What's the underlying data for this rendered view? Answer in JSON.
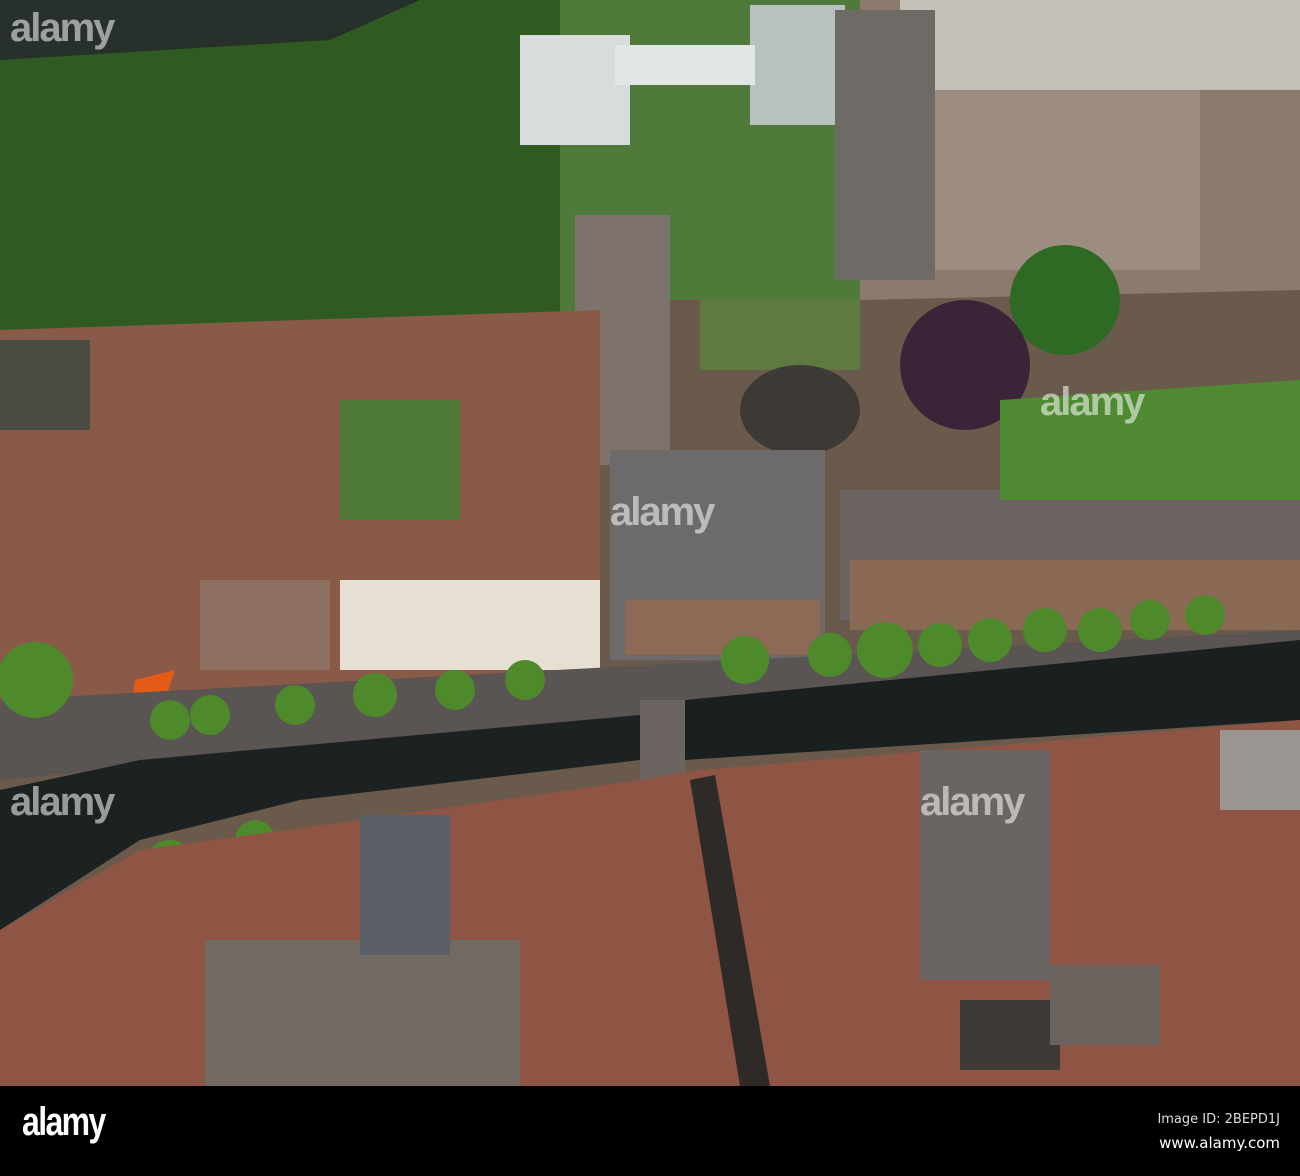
{
  "photo": {
    "description_alt": "Aerial view of canal city"
  },
  "watermark": {
    "text": "alamy"
  },
  "footer": {
    "logo": "alamy",
    "image_id": "Image ID: 2BEPD1J",
    "website": "www.alamy.com"
  }
}
